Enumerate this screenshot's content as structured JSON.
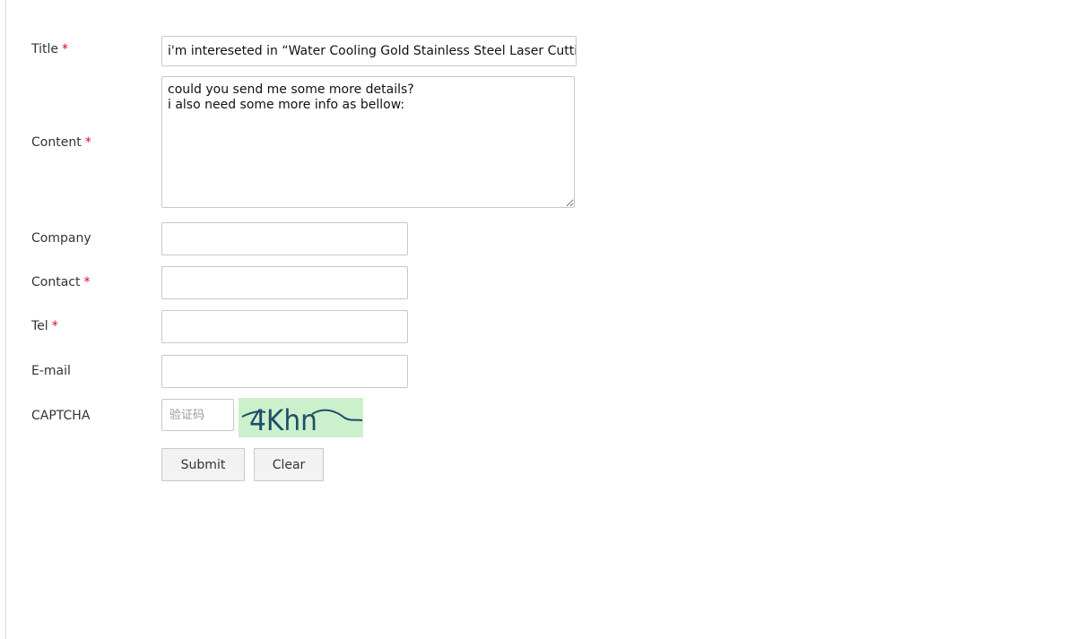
{
  "form": {
    "required_mark": "*",
    "title": {
      "label": "Title",
      "value": "i'm intereseted in   “Water Cooling Gold Stainless Steel Laser Cutting Machine”"
    },
    "content": {
      "label": "Content",
      "value": "could you send me some more details?\ni also need some more info as bellow:"
    },
    "company": {
      "label": "Company",
      "value": ""
    },
    "contact": {
      "label": "Contact",
      "value": ""
    },
    "tel": {
      "label": "Tel",
      "value": ""
    },
    "email": {
      "label": "E-mail",
      "value": ""
    },
    "captcha": {
      "label": "CAPTCHA",
      "placeholder": "验证码",
      "image_text": "4Khn",
      "image_bg": "#ccf0cc",
      "image_fg": "#1d4f66"
    },
    "buttons": {
      "submit": "Submit",
      "clear": "Clear"
    }
  },
  "colors": {
    "required": "#e2001a",
    "border": "#c8c8c8",
    "button_bg": "#f2f2f2"
  }
}
